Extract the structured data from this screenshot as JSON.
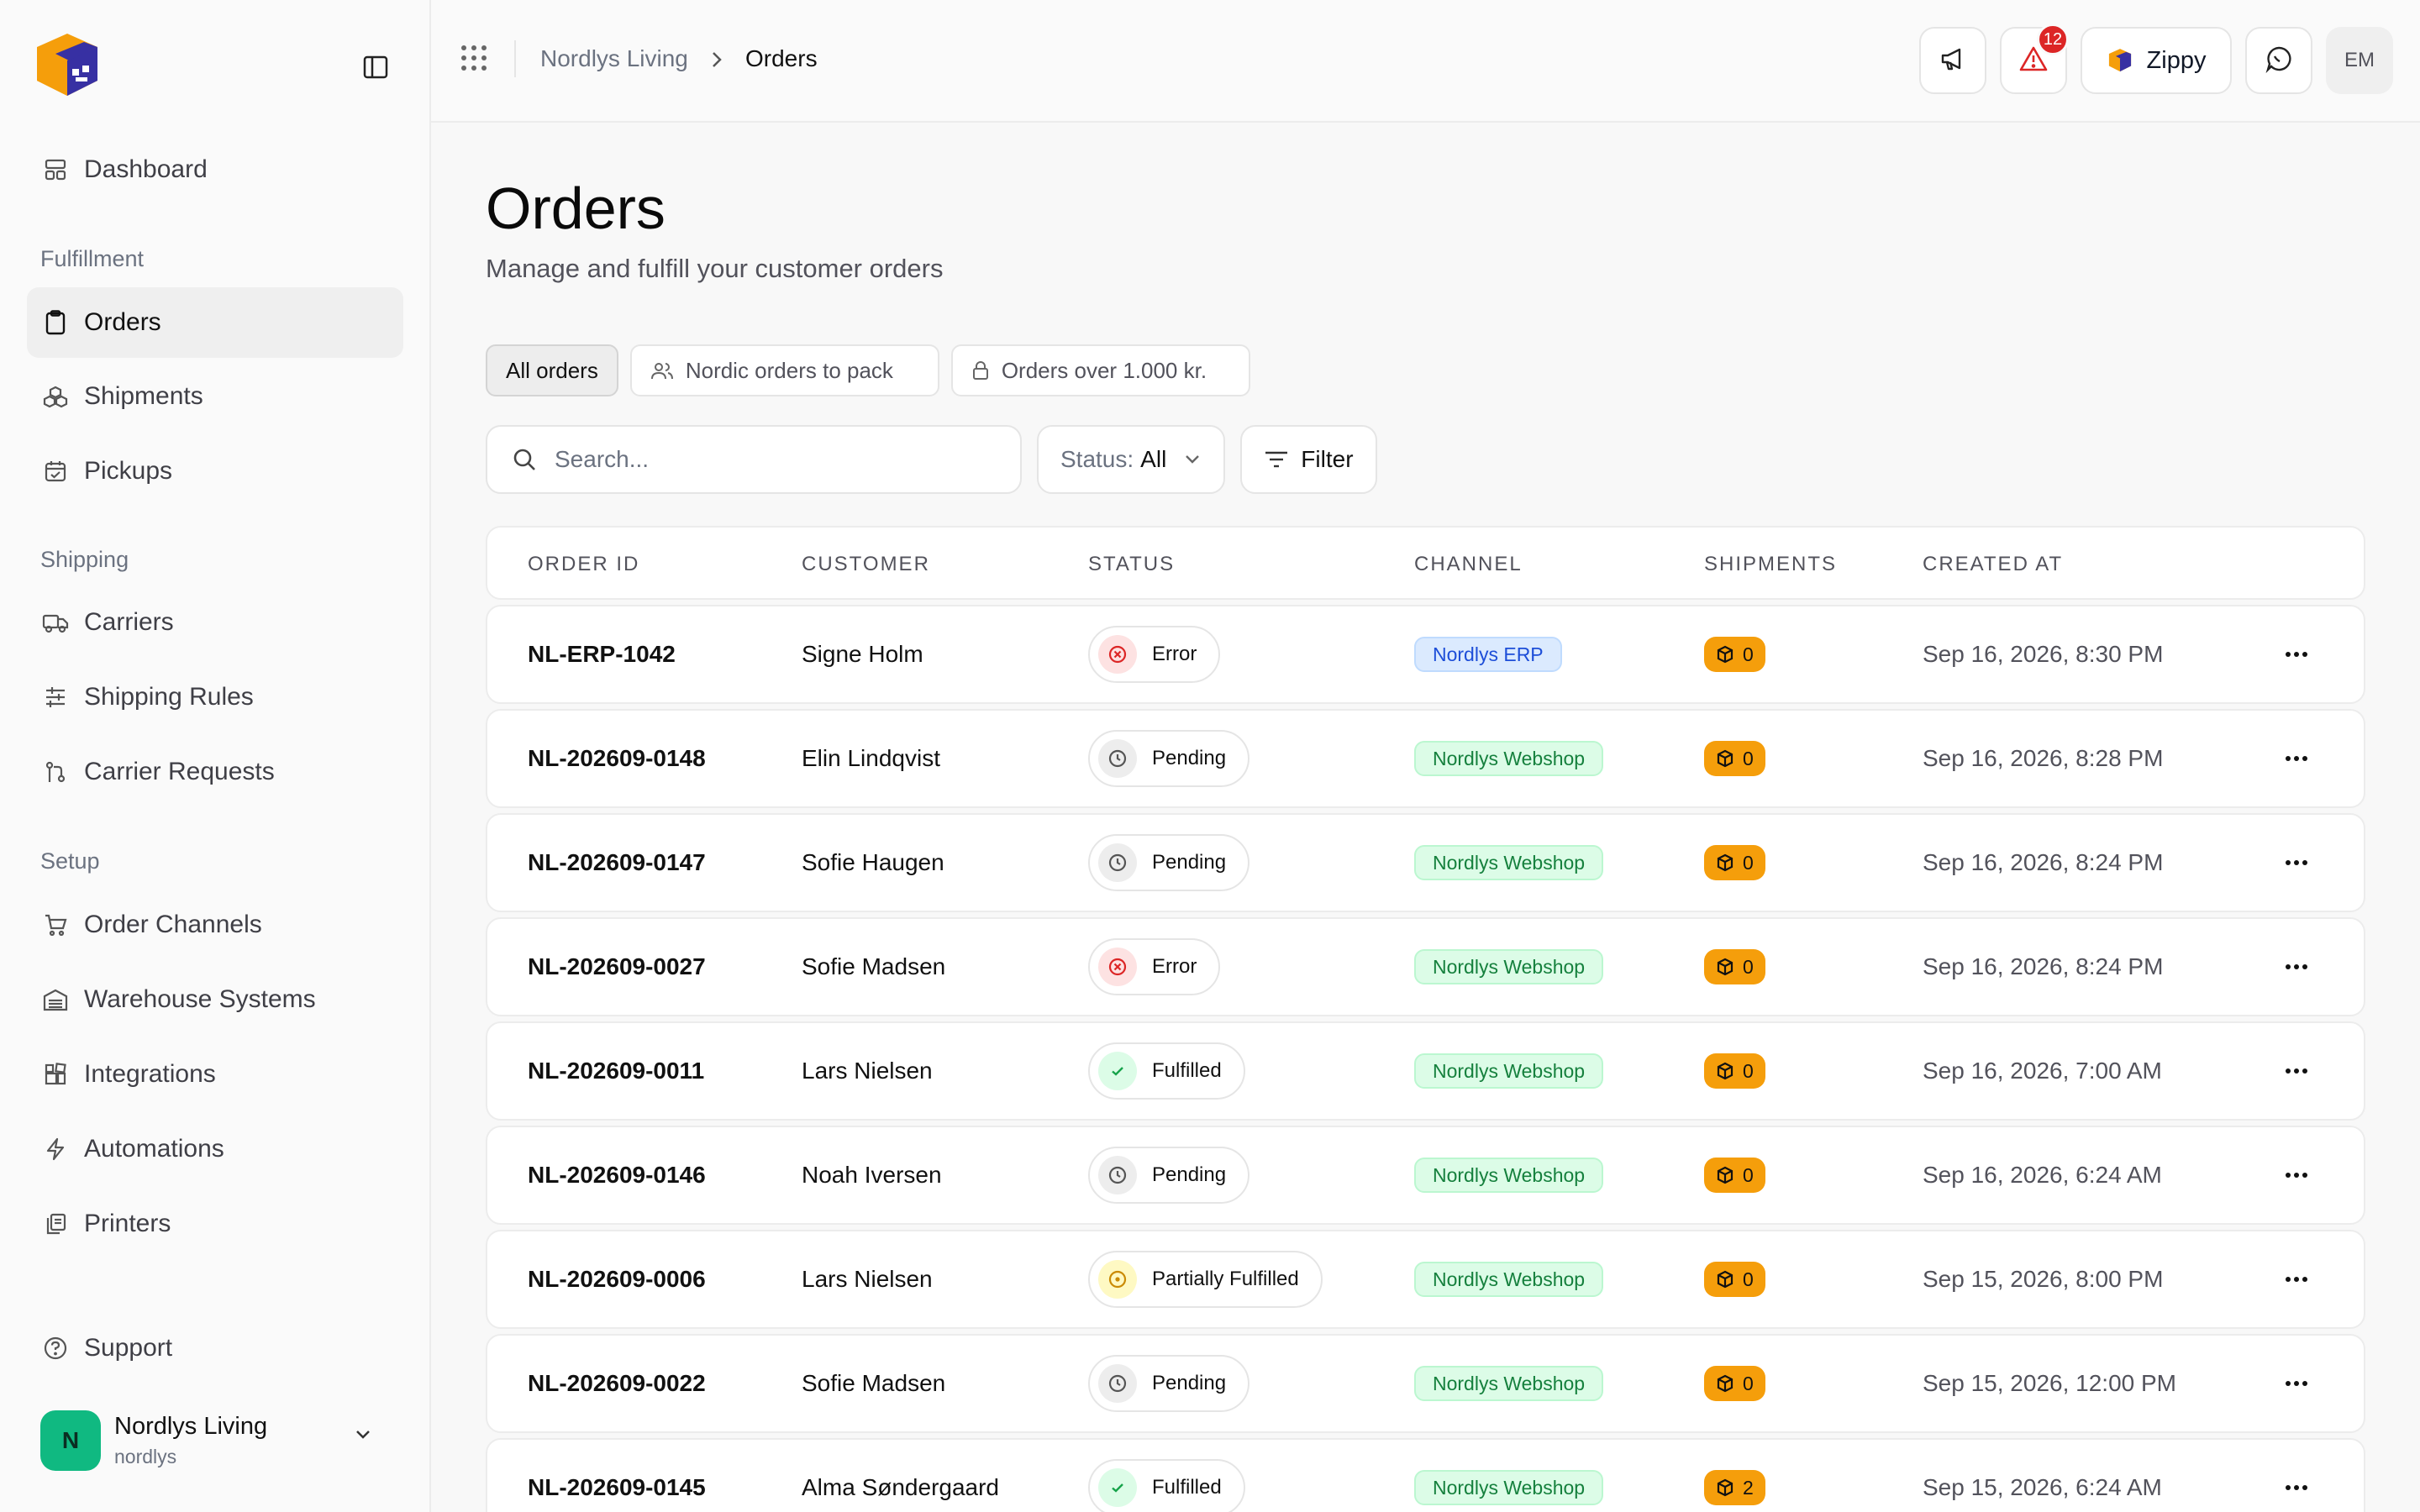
{
  "app": {
    "brand": "Zippy"
  },
  "sidebar": {
    "dashboard": "Dashboard",
    "sections": [
      {
        "title": "Fulfillment",
        "items": [
          "Orders",
          "Shipments",
          "Pickups"
        ]
      },
      {
        "title": "Shipping",
        "items": [
          "Carriers",
          "Shipping Rules",
          "Carrier Requests"
        ]
      },
      {
        "title": "Setup",
        "items": [
          "Order Channels",
          "Warehouse Systems",
          "Integrations",
          "Automations",
          "Printers"
        ]
      }
    ],
    "support": "Support",
    "account": {
      "initial": "N",
      "name": "Nordlys Living",
      "handle": "nordlys"
    }
  },
  "topbar": {
    "breadcrumb": [
      "Nordlys Living",
      "Orders"
    ],
    "alerts_count": "12",
    "brand_button": "Zippy",
    "user_initials": "EM"
  },
  "page": {
    "title": "Orders",
    "subtitle": "Manage and fulfill your customer orders"
  },
  "views": [
    "All orders",
    "Nordic orders to pack",
    "Orders over 1.000 kr."
  ],
  "toolbar": {
    "search_placeholder": "Search...",
    "status_label": "Status:",
    "status_value": "All",
    "filter_label": "Filter"
  },
  "table": {
    "columns": [
      "ORDER ID",
      "CUSTOMER",
      "STATUS",
      "CHANNEL",
      "SHIPMENTS",
      "CREATED AT"
    ],
    "rows": [
      {
        "id": "NL-ERP-1042",
        "customer": "Signe Holm",
        "status": "Error",
        "channel": "Nordlys ERP",
        "shipments": "0",
        "created": "Sep 16, 2026, 8:30 PM"
      },
      {
        "id": "NL-202609-0148",
        "customer": "Elin Lindqvist",
        "status": "Pending",
        "channel": "Nordlys Webshop",
        "shipments": "0",
        "created": "Sep 16, 2026, 8:28 PM"
      },
      {
        "id": "NL-202609-0147",
        "customer": "Sofie Haugen",
        "status": "Pending",
        "channel": "Nordlys Webshop",
        "shipments": "0",
        "created": "Sep 16, 2026, 8:24 PM"
      },
      {
        "id": "NL-202609-0027",
        "customer": "Sofie Madsen",
        "status": "Error",
        "channel": "Nordlys Webshop",
        "shipments": "0",
        "created": "Sep 16, 2026, 8:24 PM"
      },
      {
        "id": "NL-202609-0011",
        "customer": "Lars Nielsen",
        "status": "Fulfilled",
        "channel": "Nordlys Webshop",
        "shipments": "0",
        "created": "Sep 16, 2026, 7:00 AM"
      },
      {
        "id": "NL-202609-0146",
        "customer": "Noah Iversen",
        "status": "Pending",
        "channel": "Nordlys Webshop",
        "shipments": "0",
        "created": "Sep 16, 2026, 6:24 AM"
      },
      {
        "id": "NL-202609-0006",
        "customer": "Lars Nielsen",
        "status": "Partially Fulfilled",
        "channel": "Nordlys Webshop",
        "shipments": "0",
        "created": "Sep 15, 2026, 8:00 PM"
      },
      {
        "id": "NL-202609-0022",
        "customer": "Sofie Madsen",
        "status": "Pending",
        "channel": "Nordlys Webshop",
        "shipments": "0",
        "created": "Sep 15, 2026, 12:00 PM"
      },
      {
        "id": "NL-202609-0145",
        "customer": "Alma Søndergaard",
        "status": "Fulfilled",
        "channel": "Nordlys Webshop",
        "shipments": "2",
        "created": "Sep 15, 2026, 6:24 AM"
      }
    ]
  },
  "colors": {
    "accent_orange": "#f59e0b",
    "error": "#dc2626",
    "success": "#16a34a",
    "warning": "#eab308",
    "erp_channel": "#1d4ed8",
    "webshop_channel": "#15803d"
  }
}
